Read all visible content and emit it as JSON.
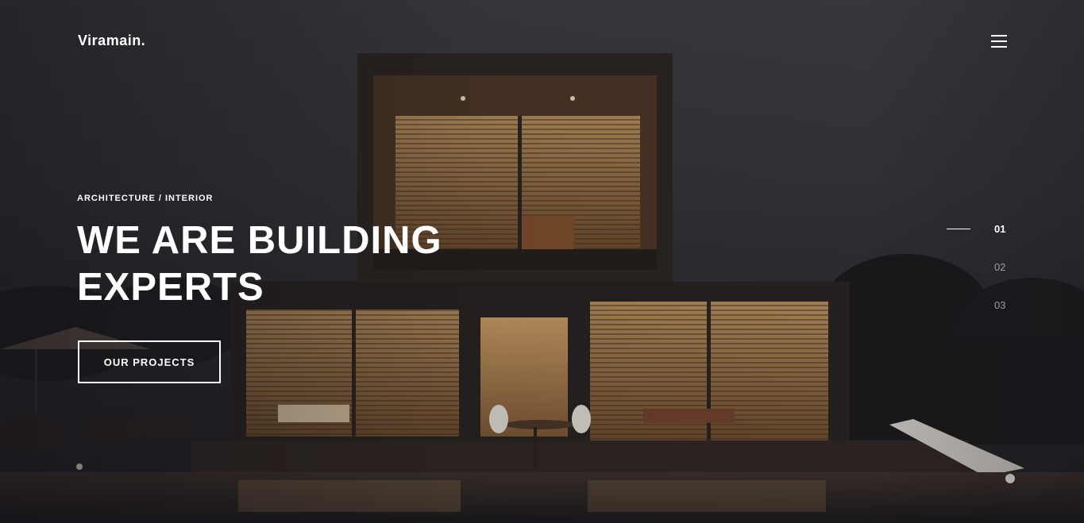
{
  "header": {
    "logo": "Viramain.",
    "menu_icon": "hamburger-menu-icon"
  },
  "hero": {
    "eyebrow": "ARCHITECTURE / INTERIOR",
    "headline_line1": "WE ARE BUILDING",
    "headline_line2": "EXPERTS",
    "cta_label": "OUR PROJECTS",
    "background_image": "modern-house-at-night-photo"
  },
  "slider": {
    "items": [
      {
        "label": "01",
        "active": true
      },
      {
        "label": "02",
        "active": false
      },
      {
        "label": "03",
        "active": false
      }
    ]
  },
  "colors": {
    "text": "#ffffff",
    "overlay": "#2b2a2e",
    "warm_light": "#c9a66b"
  }
}
